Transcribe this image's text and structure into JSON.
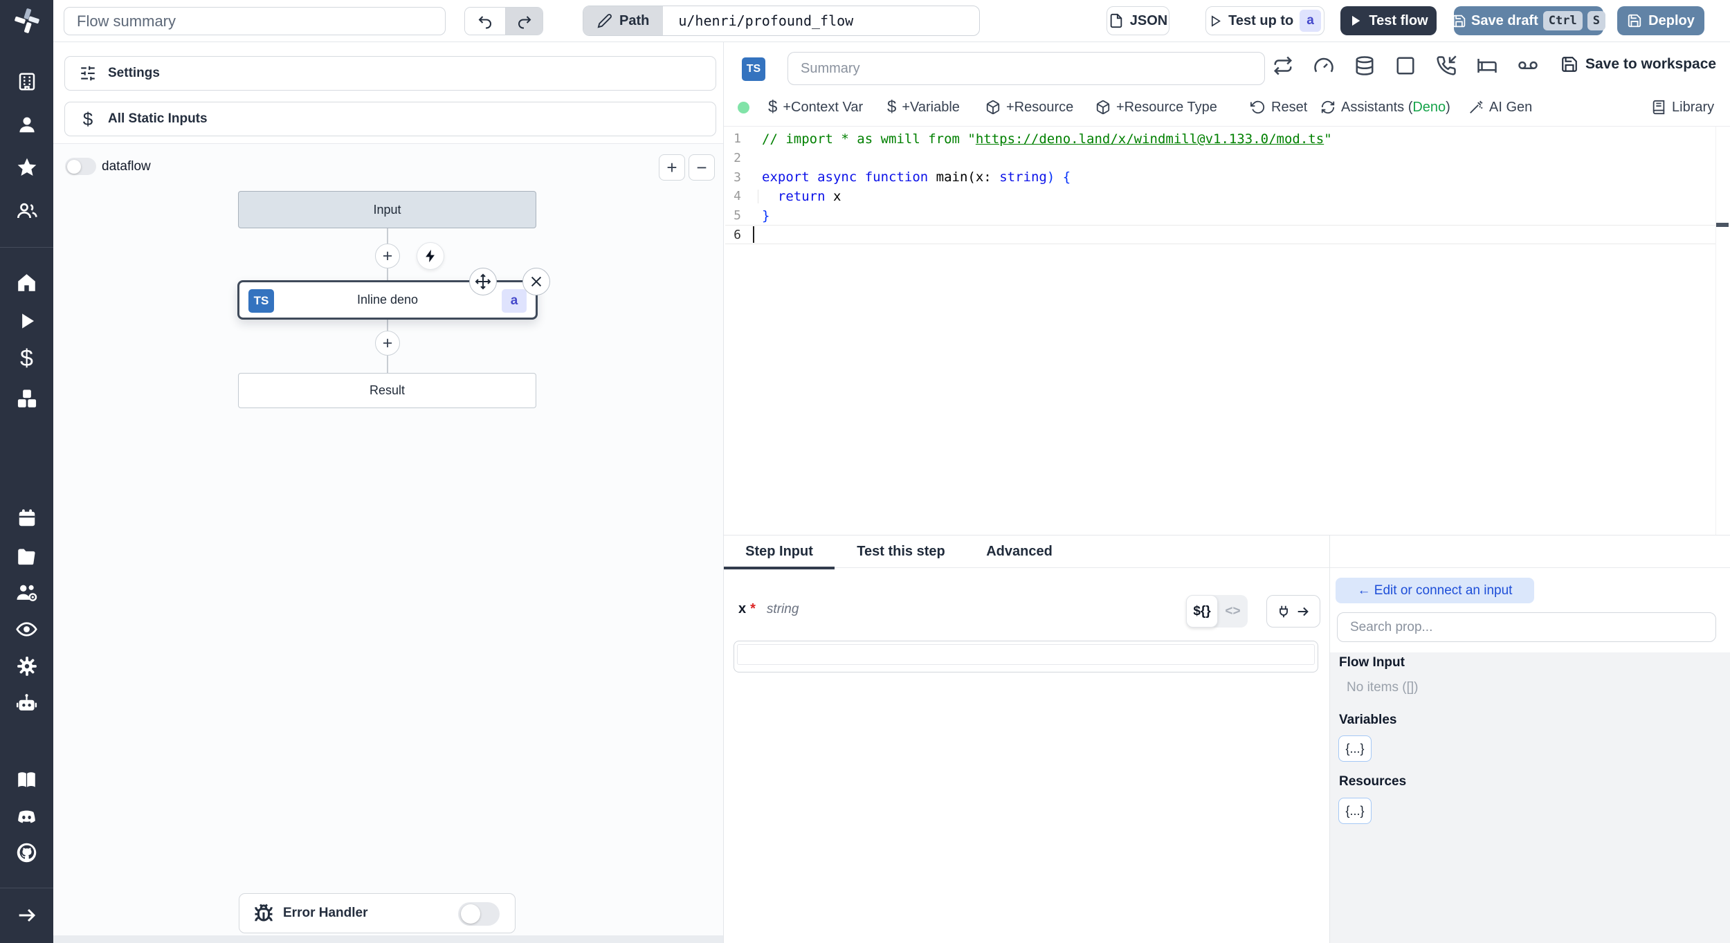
{
  "topbar": {
    "flow_summary_placeholder": "Flow summary",
    "path_label": "Path",
    "path_value": "u/henri/profound_flow",
    "json_button": "JSON",
    "test_up_to": "Test up to",
    "test_up_to_badge": "a",
    "test_flow": "Test flow",
    "save_draft": "Save draft",
    "kbd_ctrl": "Ctrl",
    "kbd_s": "S",
    "deploy": "Deploy"
  },
  "flow": {
    "settings": "Settings",
    "all_static_inputs": "All Static Inputs",
    "dataflow": "dataflow",
    "zoom_in": "+",
    "zoom_out": "−",
    "input_node": "Input",
    "step_node": "Inline deno",
    "step_lang": "TS",
    "step_badge": "a",
    "result_node": "Result",
    "error_handler": "Error Handler",
    "plus": "+"
  },
  "editor": {
    "lang_badge": "TS",
    "summary_placeholder": "Summary",
    "save_to_workspace": "Save to workspace",
    "context_var": "+Context Var",
    "variable": "+Variable",
    "resource": "+Resource",
    "resource_type": "+Resource Type",
    "reset": "Reset",
    "assistants_prefix": "Assistants (",
    "assistants_lang": "Deno",
    "assistants_suffix": ")",
    "ai_gen": "AI Gen",
    "library": "Library",
    "dollar": "$",
    "code": {
      "nums": [
        "1",
        "2",
        "3",
        "4",
        "5",
        "6"
      ],
      "l1a": "// import * as wmill from \"",
      "l1b": "https://deno.land/x/windmill@v1.133.0/mod.ts",
      "l1c": "\"",
      "l3a": "export async function ",
      "l3b": "main(x: ",
      "l3c": "string",
      "l3d": ") {",
      "l4a": "  return",
      "l4b": " x",
      "l5": "}"
    }
  },
  "step": {
    "tabs": [
      "Step Input",
      "Test this step",
      "Advanced"
    ],
    "arg_name": "x",
    "required_mark": "*",
    "arg_type": "string",
    "toggle_expr": "${}",
    "toggle_code": "<>"
  },
  "props": {
    "edit_connect": "← Edit or connect an input",
    "search_placeholder": "Search prop...",
    "flow_input": "Flow Input",
    "no_items": "No items ([])",
    "variables": "Variables",
    "resources": "Resources",
    "braces": "{...}"
  }
}
